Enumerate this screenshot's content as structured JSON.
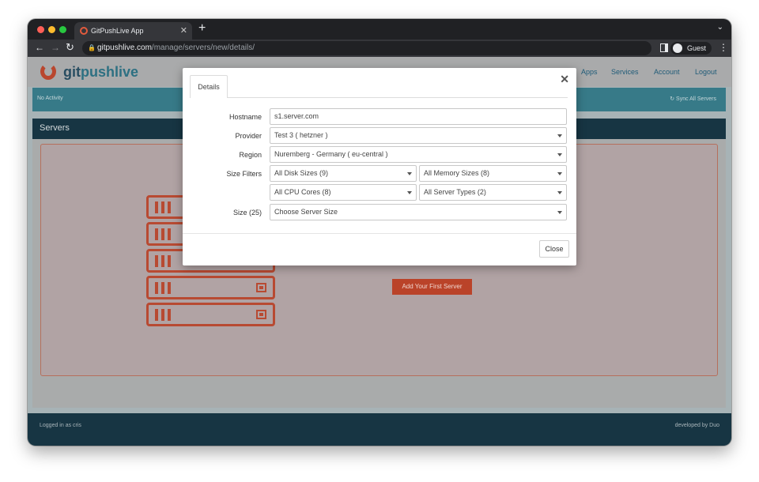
{
  "browser": {
    "tab_title": "GitPushLive App",
    "tab_close": "✕",
    "new_tab": "+",
    "url_domain": "gitpushlive.com",
    "url_path": "/manage/servers/new/details/",
    "profile_name": "Guest"
  },
  "app": {
    "brand_first": "git",
    "brand_second": "pushlive",
    "nav": [
      "Apps",
      "Services",
      "Account",
      "Logout"
    ],
    "activity_status": "No Activity",
    "sync_label": "Sync All Servers",
    "section_title": "Servers",
    "cta_label": "Add Your First Server",
    "footer_left": "Logged in as cris",
    "footer_right": "developed by Duo"
  },
  "modal": {
    "tab_label": "Details",
    "close_x": "✕",
    "fields": {
      "hostname_label": "Hostname",
      "hostname_value": "s1.server.com",
      "provider_label": "Provider",
      "provider_value": "Test 3 ( hetzner )",
      "region_label": "Region",
      "region_value": "Nuremberg - Germany ( eu-central )",
      "size_filters_label": "Size Filters",
      "disk_value": "All Disk Sizes (9)",
      "memory_value": "All Memory Sizes (8)",
      "cpu_value": "All CPU Cores (8)",
      "server_types_value": "All Server Types (2)",
      "size_label": "Size (25)",
      "size_value": "Choose Server Size"
    },
    "close_button": "Close"
  },
  "colors": {
    "accent": "#b84a32",
    "navy": "#173543",
    "teal": "#377a88"
  }
}
